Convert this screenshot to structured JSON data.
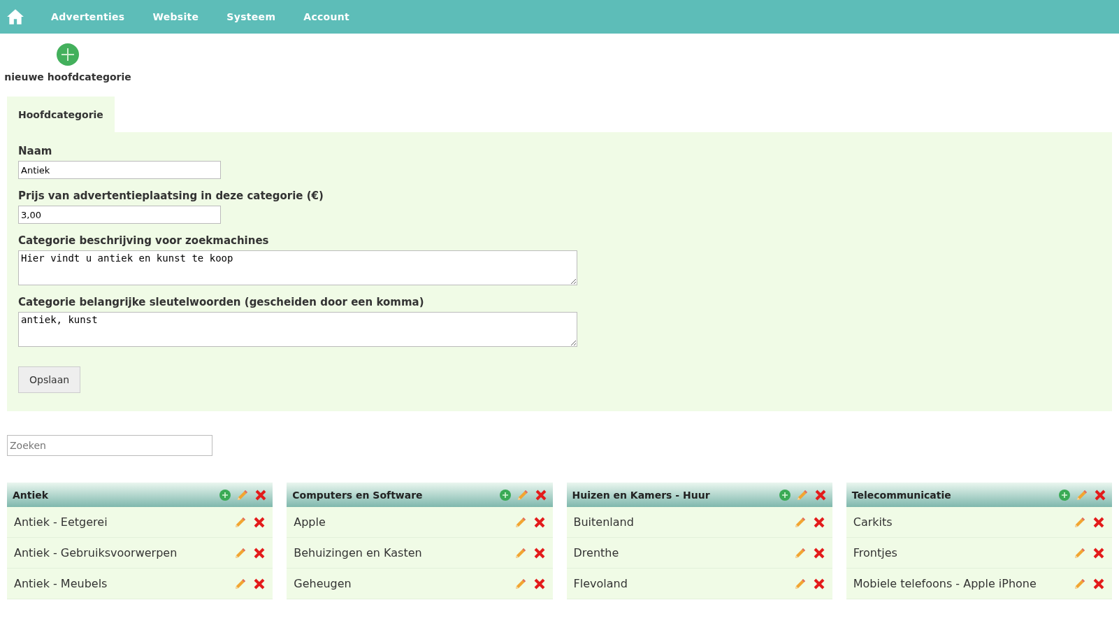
{
  "nav": {
    "items": [
      "Advertenties",
      "Website",
      "Systeem",
      "Account"
    ]
  },
  "new_category": {
    "label": "nieuwe hoofdcategorie"
  },
  "tabs": [
    {
      "label": "Hoofdcategorie",
      "selected": true
    }
  ],
  "form": {
    "fields": [
      {
        "kind": "input",
        "label": "Naam",
        "value": "Antiek"
      },
      {
        "kind": "input",
        "label": "Prijs van advertentieplaatsing in deze categorie (€)",
        "value": "3,00"
      },
      {
        "kind": "textarea",
        "label": "Categorie beschrijving voor zoekmachines",
        "value": "Hier vindt u antiek en kunst te koop"
      },
      {
        "kind": "textarea",
        "label": "Categorie belangrijke sleutelwoorden (gescheiden door een komma)",
        "value": "antiek, kunst"
      }
    ],
    "save_button": "Opslaan"
  },
  "search": {
    "placeholder": "Zoeken"
  },
  "categories": [
    {
      "title": "Antiek",
      "items": [
        "Antiek - Eetgerei",
        "Antiek - Gebruiksvoorwerpen",
        "Antiek - Meubels"
      ]
    },
    {
      "title": "Computers en Software",
      "items": [
        "Apple",
        "Behuizingen en Kasten",
        "Geheugen"
      ]
    },
    {
      "title": "Huizen en Kamers - Huur",
      "items": [
        "Buitenland",
        "Drenthe",
        "Flevoland"
      ]
    },
    {
      "title": "Telecommunicatie",
      "items": [
        "Carkits",
        "Frontjes",
        "Mobiele telefoons - Apple iPhone"
      ]
    }
  ]
}
